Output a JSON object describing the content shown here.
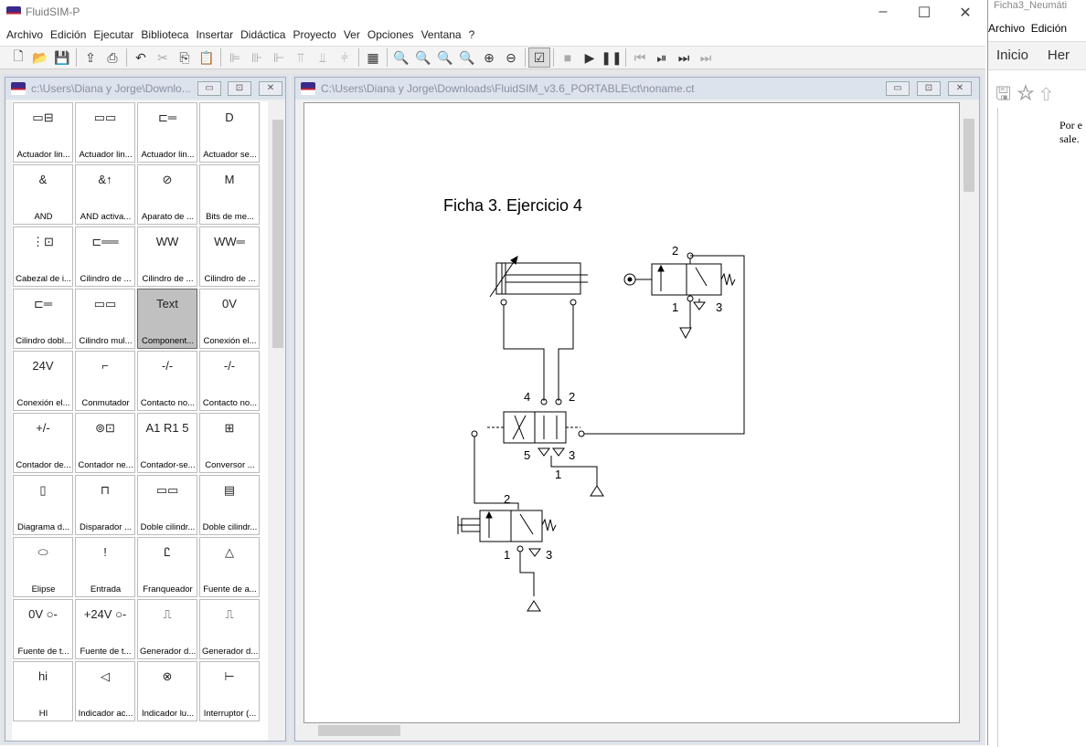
{
  "app": {
    "title": "FluidSIM-P"
  },
  "menu": [
    "Archivo",
    "Edición",
    "Ejecutar",
    "Biblioteca",
    "Insertar",
    "Didáctica",
    "Proyecto",
    "Ver",
    "Opciones",
    "Ventana",
    "?"
  ],
  "library_window": {
    "title": "c:\\Users\\Diana y Jorge\\Downlo...",
    "items": [
      {
        "label": "Actuador lin...",
        "icon": "▭⊟"
      },
      {
        "label": "Actuador lin...",
        "icon": "▭▭"
      },
      {
        "label": "Actuador lin...",
        "icon": "⊏═"
      },
      {
        "label": "Actuador se...",
        "icon": "D"
      },
      {
        "label": "AND",
        "icon": "&"
      },
      {
        "label": "AND activa...",
        "icon": "&↑"
      },
      {
        "label": "Aparato de ...",
        "icon": "⊘"
      },
      {
        "label": "Bits de me...",
        "icon": "M"
      },
      {
        "label": "Cabezal de i...",
        "icon": "⋮⊡"
      },
      {
        "label": "Cilindro de ...",
        "icon": "⊏══"
      },
      {
        "label": "Cilindro de ...",
        "icon": "WW"
      },
      {
        "label": "Cilindro de ...",
        "icon": "WW═"
      },
      {
        "label": "Cilindro dobl...",
        "icon": "⊏═"
      },
      {
        "label": "Cilindro mul...",
        "icon": "▭▭"
      },
      {
        "label": "Component...",
        "icon": "Text",
        "selected": true
      },
      {
        "label": "Conexión el...",
        "icon": "0V"
      },
      {
        "label": "Conexión el...",
        "icon": "24V"
      },
      {
        "label": "Conmutador",
        "icon": "⌐"
      },
      {
        "label": "Contacto no...",
        "icon": "-/-"
      },
      {
        "label": "Contacto no...",
        "icon": "-/-"
      },
      {
        "label": "Contador de...",
        "icon": "+/-"
      },
      {
        "label": "Contador ne...",
        "icon": "⊚⊡"
      },
      {
        "label": "Contador-se...",
        "icon": "A1 R1 5"
      },
      {
        "label": "Conversor ...",
        "icon": "⊞"
      },
      {
        "label": "Diagrama d...",
        "icon": "▯"
      },
      {
        "label": "Disparador ...",
        "icon": "⊓"
      },
      {
        "label": "Doble cilindr...",
        "icon": "▭▭"
      },
      {
        "label": "Doble cilindr...",
        "icon": "▤"
      },
      {
        "label": "Elipse",
        "icon": "⬭"
      },
      {
        "label": "Entrada",
        "icon": "!"
      },
      {
        "label": "Franqueador",
        "icon": "Ꮭ"
      },
      {
        "label": "Fuente de a...",
        "icon": "△"
      },
      {
        "label": "Fuente de t...",
        "icon": "0V ○-"
      },
      {
        "label": "Fuente de t...",
        "icon": "+24V ○-"
      },
      {
        "label": "Generador d...",
        "icon": "⎍"
      },
      {
        "label": "Generador d...",
        "icon": "⎍"
      },
      {
        "label": "HI",
        "icon": "hi"
      },
      {
        "label": "Indicador ac...",
        "icon": "◁"
      },
      {
        "label": "Indicador lu...",
        "icon": "⊗"
      },
      {
        "label": "Interruptor (...",
        "icon": "⊢"
      }
    ]
  },
  "canvas_window": {
    "title": "C:\\Users\\Diana y Jorge\\Downloads\\FluidSIM_v3.6_PORTABLE\\ct\\noname.ct",
    "diagram": {
      "title": "Ficha 3. Ejercicio 4",
      "ports": {
        "v1_2": "2",
        "v1_1": "1",
        "v1_3": "3",
        "v2_4": "4",
        "v2_2": "2",
        "v2_5": "5",
        "v2_3": "3",
        "v2_1": "1",
        "v3_2": "2",
        "v3_1": "1",
        "v3_3": "3"
      }
    }
  },
  "right_app": {
    "title": "Ficha3_Neumáti",
    "menu": [
      "Archivo",
      "Edición"
    ],
    "tabs": [
      "Inicio",
      "Her"
    ],
    "text": "Por e sale."
  }
}
